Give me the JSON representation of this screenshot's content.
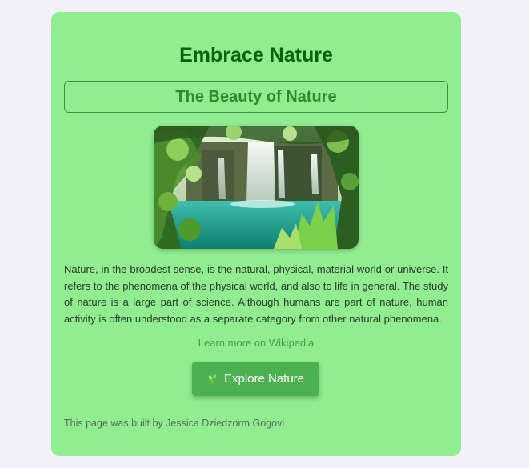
{
  "page": {
    "title": "Embrace Nature",
    "subtitle": "The Beauty of Nature",
    "description": "Nature, in the broadest sense, is the natural, physical, material world or universe. It refers to the phenomena of the physical world, and also to life in general. The study of nature is a large part of science. Although humans are part of nature, human activity is often understood as a separate category from other natural phenomena.",
    "link_text": "Learn more on Wikipedia",
    "button_label": "Explore Nature",
    "button_icon": "leaf-icon",
    "footer": "This page was built by Jessica Dziedzorm Gogovi"
  },
  "colors": {
    "page_background": "#f3f1f8",
    "card_background": "#90ee90",
    "title": "#006400",
    "subtitle": "#2f8a2f",
    "button": "#4caf50",
    "link": "#4c9c4c"
  }
}
